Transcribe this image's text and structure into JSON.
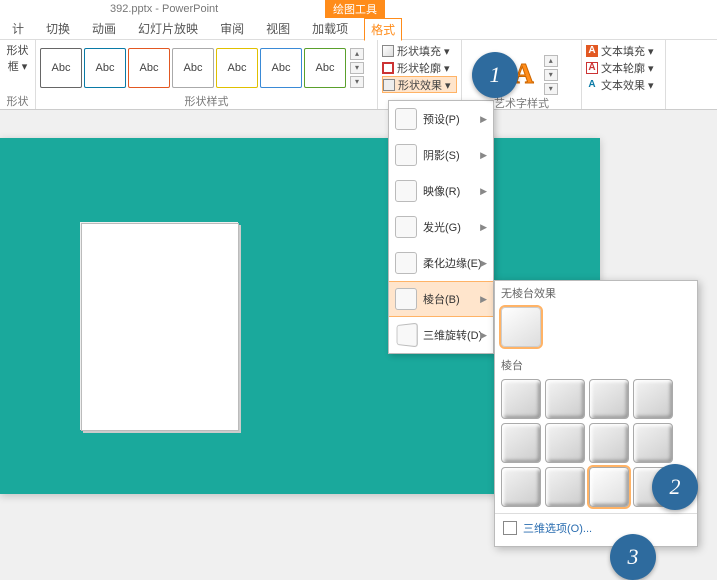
{
  "titlebar": {
    "filename": "392.pptx - PowerPoint",
    "contextual_tool": "绘图工具"
  },
  "tabs": [
    "计",
    "切换",
    "动画",
    "幻灯片放映",
    "审阅",
    "视图",
    "加载项"
  ],
  "active_tab": "格式",
  "ribbon": {
    "shape_group": {
      "shape_btn": "形状",
      "frame_btn": "框 ▾",
      "label": "形状"
    },
    "style_group": {
      "sample_text": "Abc",
      "label": "形状样式"
    },
    "fill_group": {
      "fill": "形状填充 ▾",
      "outline": "形状轮廓 ▾",
      "effects": "形状效果 ▾"
    },
    "wordart_group": {
      "letter": "A",
      "label": "艺术字样式"
    },
    "text_group": {
      "fill": "文本填充 ▾",
      "outline": "文本轮廓 ▾",
      "effects": "文本效果 ▾"
    }
  },
  "effects_menu": {
    "items": [
      {
        "label": "预设(P)"
      },
      {
        "label": "阴影(S)"
      },
      {
        "label": "映像(R)"
      },
      {
        "label": "发光(G)"
      },
      {
        "label": "柔化边缘(E)"
      },
      {
        "label": "棱台(B)"
      },
      {
        "label": "三维旋转(D)"
      }
    ],
    "active_index": 5
  },
  "bevel_panel": {
    "none_header": "无棱台效果",
    "bevel_header": "棱台",
    "options_link": "三维选项(O)..."
  },
  "callouts": {
    "c1": "1",
    "c2": "2",
    "c3": "3"
  }
}
